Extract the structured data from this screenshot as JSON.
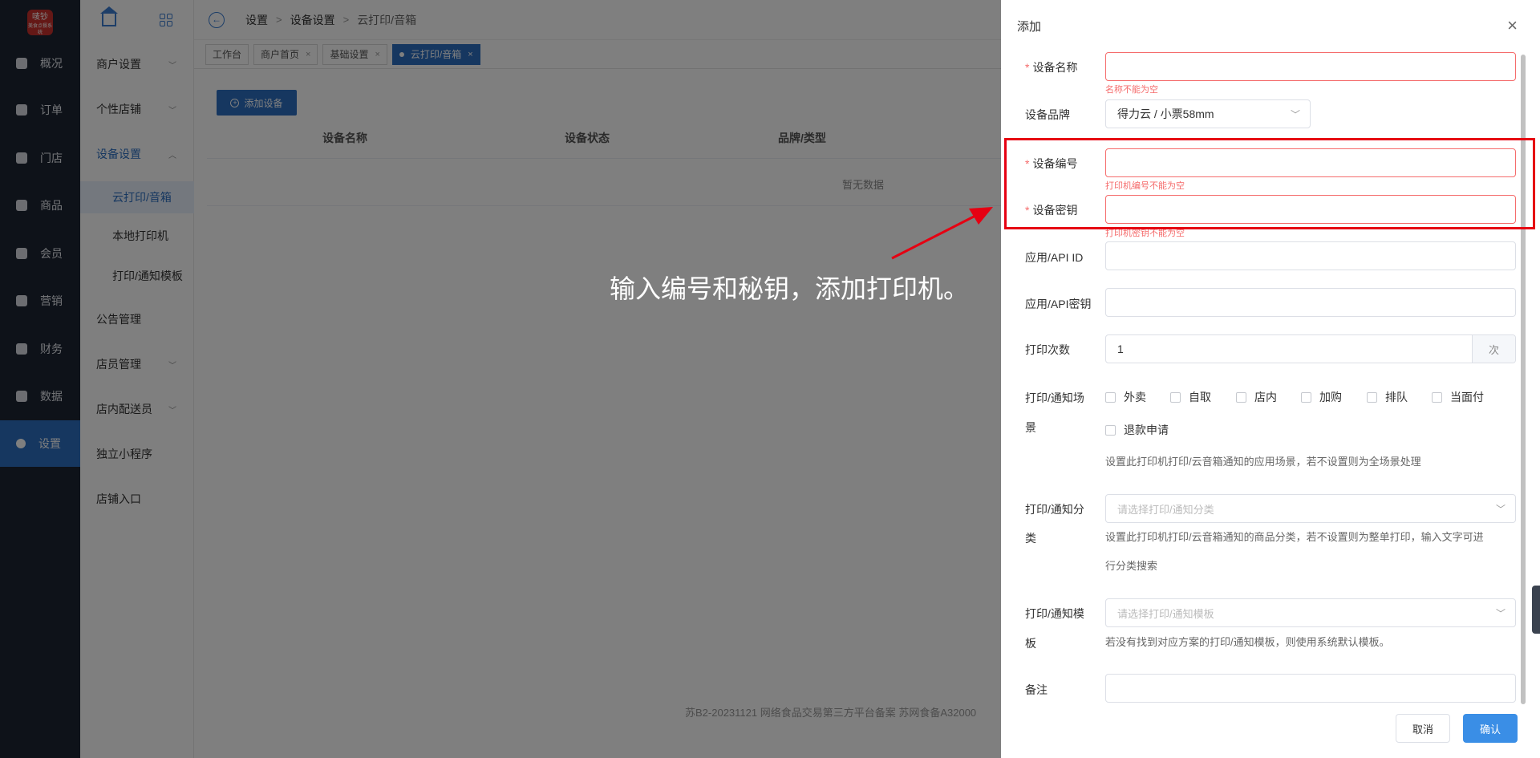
{
  "logo": {
    "main": "唛钞",
    "sub": "美食点餐系统"
  },
  "nav": [
    {
      "label": "概况",
      "icon": "overview-icon"
    },
    {
      "label": "订单",
      "icon": "order-icon"
    },
    {
      "label": "门店",
      "icon": "store-icon"
    },
    {
      "label": "商品",
      "icon": "goods-icon"
    },
    {
      "label": "会员",
      "icon": "member-icon"
    },
    {
      "label": "营销",
      "icon": "marketing-icon"
    },
    {
      "label": "财务",
      "icon": "finance-icon"
    },
    {
      "label": "数据",
      "icon": "data-icon"
    },
    {
      "label": "设置",
      "icon": "settings-icon"
    }
  ],
  "submenu": {
    "items": [
      {
        "label": "商户设置"
      },
      {
        "label": "个性店铺"
      },
      {
        "label": "设备设置"
      },
      {
        "label": "云打印/音箱"
      },
      {
        "label": "本地打印机"
      },
      {
        "label": "打印/通知模板"
      },
      {
        "label": "公告管理"
      },
      {
        "label": "店员管理"
      },
      {
        "label": "店内配送员"
      },
      {
        "label": "独立小程序"
      },
      {
        "label": "店铺入口"
      }
    ]
  },
  "breadcrumb": [
    "设置",
    "设备设置",
    "云打印/音箱"
  ],
  "tags": [
    {
      "label": "工作台"
    },
    {
      "label": "商户首页"
    },
    {
      "label": "基础设置"
    },
    {
      "label": "云打印/音箱"
    }
  ],
  "content": {
    "add_button": "添加设备",
    "columns": [
      "设备名称",
      "设备状态",
      "品牌/类型"
    ],
    "empty_text": "暂无数据",
    "footer": "苏B2-20231121  网络食品交易第三方平台备案 苏网食备A32000"
  },
  "annotation": "输入编号和秘钥，添加打印机。",
  "drawer": {
    "title": "添加",
    "fields": {
      "name": {
        "label": "设备名称",
        "error": "名称不能为空",
        "value": ""
      },
      "brand": {
        "label": "设备品牌",
        "value": "得力云 / 小票58mm"
      },
      "number": {
        "label": "设备编号",
        "error": "打印机编号不能为空",
        "value": ""
      },
      "secret": {
        "label": "设备密钥",
        "error": "打印机密钥不能为空",
        "value": ""
      },
      "api_id": {
        "label": "应用/API ID",
        "value": ""
      },
      "api_secret": {
        "label": "应用/API密钥",
        "value": ""
      },
      "print_count": {
        "label": "打印次数",
        "value": "1",
        "suffix": "次"
      },
      "scene": {
        "label_line1": "打印/通知场",
        "label_line2": "景",
        "options": [
          "外卖",
          "自取",
          "店内",
          "加购",
          "排队",
          "当面付",
          "退款申请"
        ],
        "hint": "设置此打印机打印/云音箱通知的应用场景，若不设置则为全场景处理"
      },
      "category": {
        "label_line1": "打印/通知分",
        "label_line2": "类",
        "placeholder": "请选择打印/通知分类",
        "hint_line1": "设置此打印机打印/云音箱通知的商品分类，若不设置则为整单打印，输入文字可进",
        "hint_line2": "行分类搜索"
      },
      "template": {
        "label_line1": "打印/通知模",
        "label_line2": "板",
        "placeholder": "请选择打印/通知模板",
        "hint": "若没有找到对应方案的打印/通知模板，则使用系统默认模板。"
      },
      "remark": {
        "label": "备注",
        "value": ""
      }
    },
    "cancel": "取消",
    "confirm": "确认"
  },
  "colors": {
    "primary": "#2d6fc1",
    "error": "#f56c6c",
    "highlight": "#e60012",
    "nav_bg": "#1c2433"
  }
}
